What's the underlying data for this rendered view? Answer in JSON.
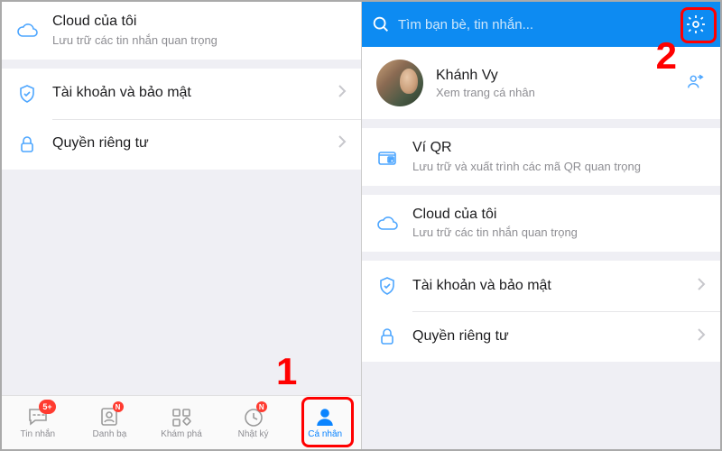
{
  "left": {
    "cloud": {
      "title": "Cloud của tôi",
      "sub": "Lưu trữ các tin nhắn quan trọng"
    },
    "account": {
      "title": "Tài khoản và bảo mật"
    },
    "privacy": {
      "title": "Quyền riêng tư"
    },
    "tabs": {
      "messages": {
        "label": "Tin nhắn",
        "badge": "5+"
      },
      "contacts": {
        "label": "Danh bạ",
        "badge": "N"
      },
      "discover": {
        "label": "Khám phá"
      },
      "diary": {
        "label": "Nhật ký",
        "badge": "N"
      },
      "me": {
        "label": "Cá nhân"
      }
    }
  },
  "right": {
    "search_placeholder": "Tìm bạn bè, tin nhắn...",
    "profile": {
      "name": "Khánh Vy",
      "sub": "Xem trang cá nhân"
    },
    "qr": {
      "title": "Ví QR",
      "sub": "Lưu trữ và xuất trình các mã QR quan trọng"
    },
    "cloud": {
      "title": "Cloud của tôi",
      "sub": "Lưu trữ các tin nhắn quan trọng"
    },
    "account": {
      "title": "Tài khoản và bảo mật"
    },
    "privacy": {
      "title": "Quyền riêng tư"
    }
  },
  "annotations": {
    "step1": "1",
    "step2": "2"
  },
  "colors": {
    "accent": "#0d8bf2",
    "iconBlue": "#4da6ff",
    "danger": "#ff0000"
  }
}
